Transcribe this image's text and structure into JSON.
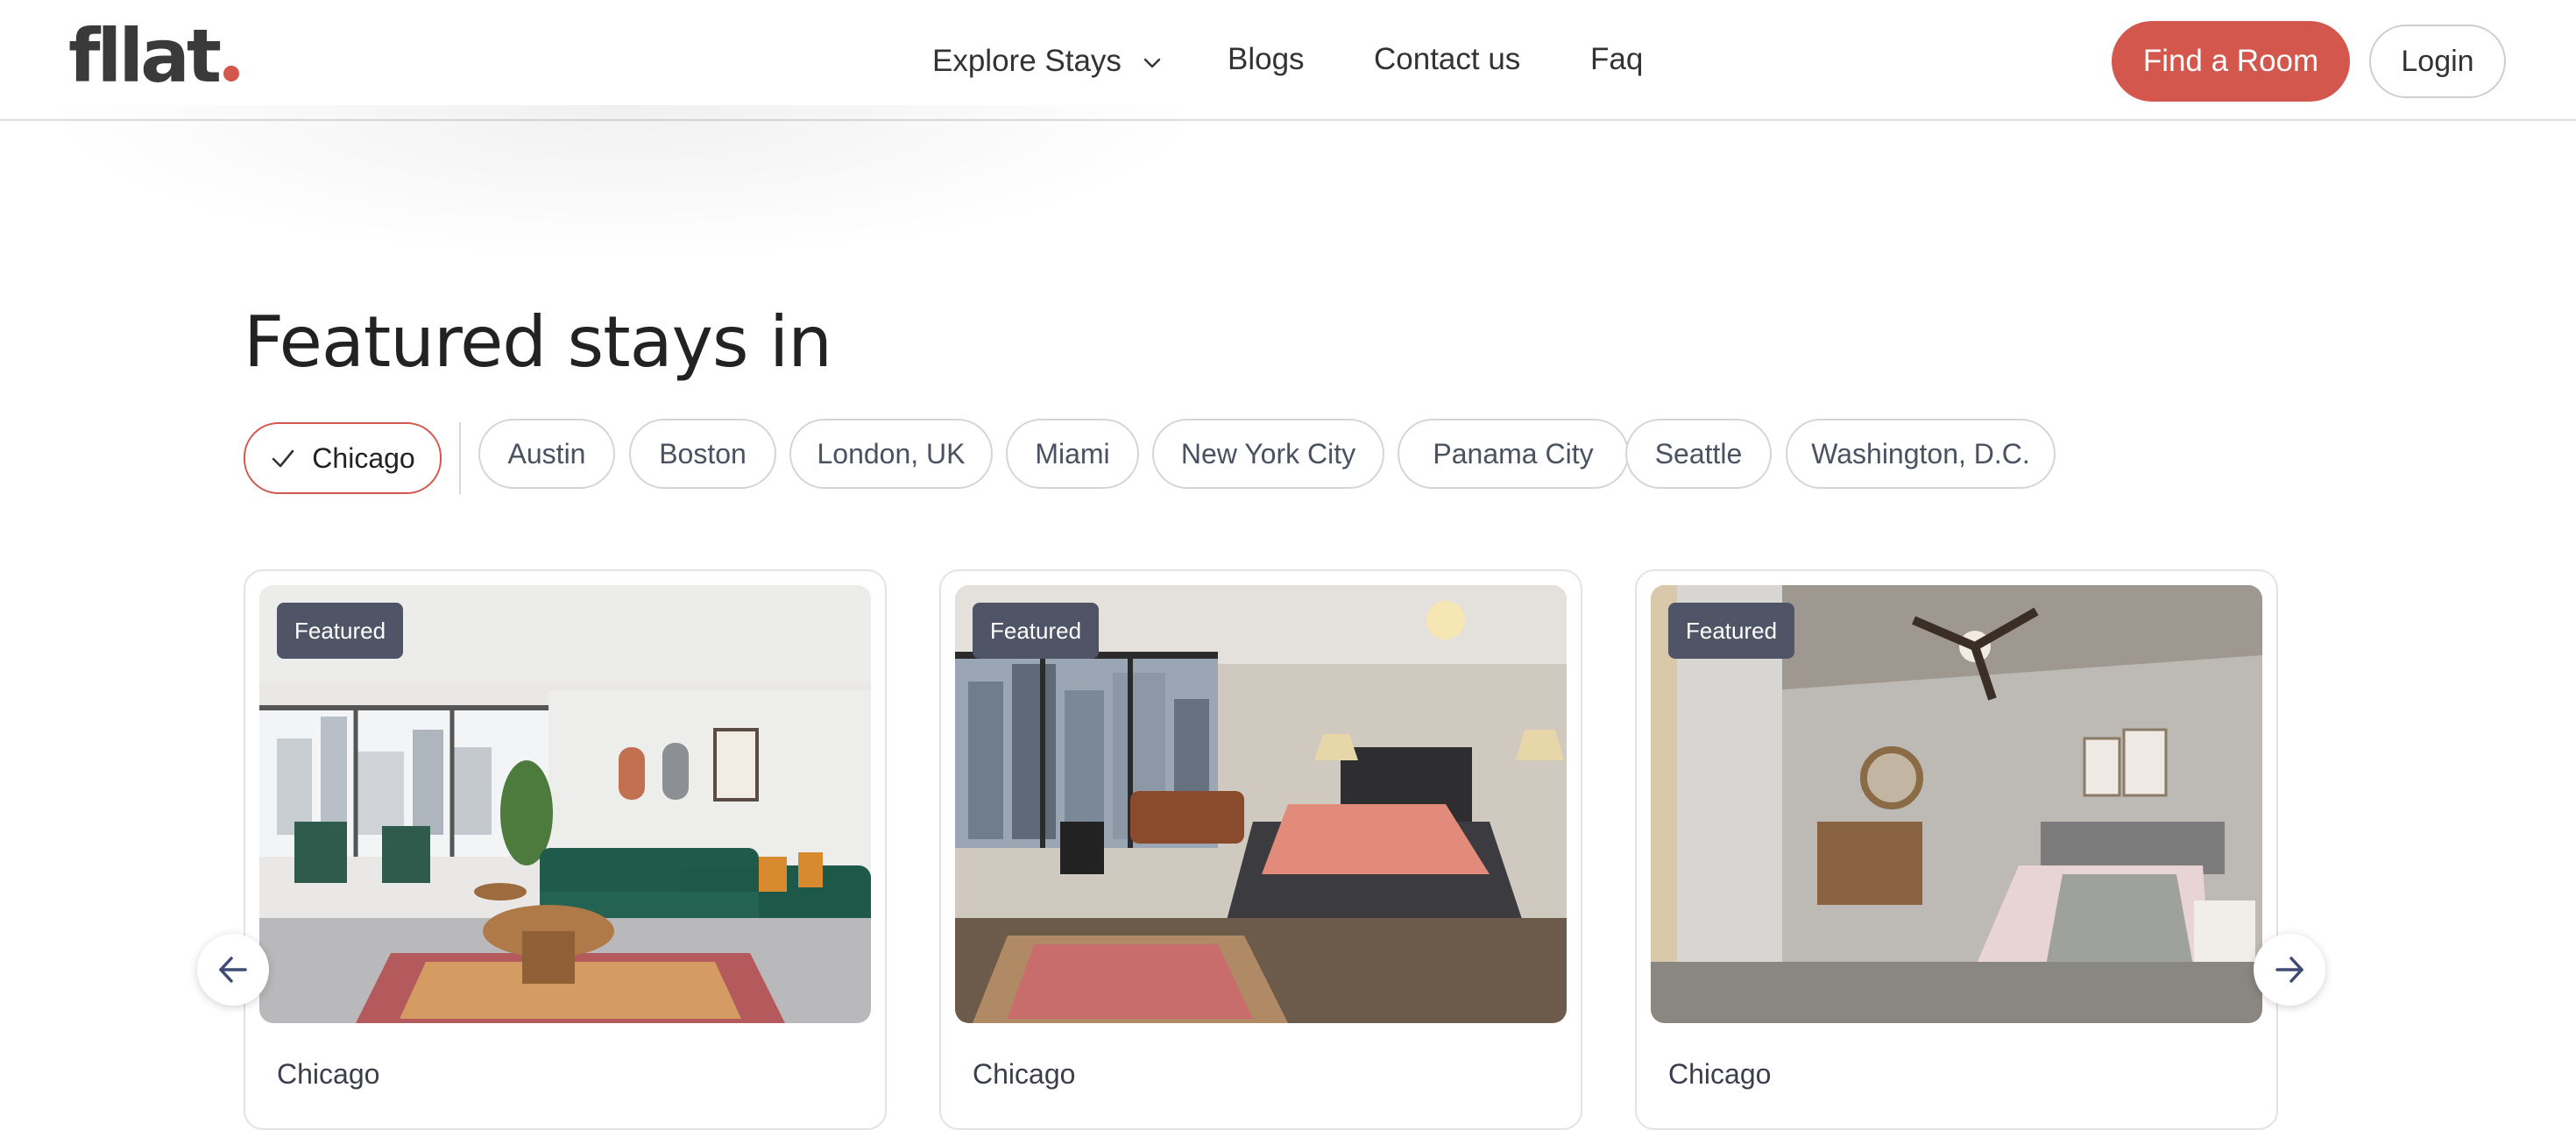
{
  "header": {
    "logo_text": "fllat",
    "nav": {
      "explore_label": "Explore Stays",
      "blogs_label": "Blogs",
      "contact_label": "Contact us",
      "faq_label": "Faq"
    },
    "find_room_label": "Find a Room",
    "login_label": "Login"
  },
  "featured": {
    "title": "Featured stays in",
    "selected_city": "Chicago",
    "cities": [
      "Austin",
      "Boston",
      "London, UK",
      "Miami",
      "New York City",
      "Panama City",
      "Seattle",
      "Washington, D.C."
    ]
  },
  "cards": [
    {
      "badge": "Featured",
      "city": "Chicago",
      "photo": "living-room-photo"
    },
    {
      "badge": "Featured",
      "city": "Chicago",
      "photo": "bedroom-photo"
    },
    {
      "badge": "Featured",
      "city": "Chicago",
      "photo": "bedroom-photo"
    }
  ],
  "colors": {
    "brand_red": "#d3574d",
    "badge_bg": "#4f5566",
    "nav_arrow": "#3f4a75"
  },
  "icons": [
    "chevron-down-icon",
    "check-icon",
    "arrow-left-icon",
    "arrow-right-icon"
  ]
}
